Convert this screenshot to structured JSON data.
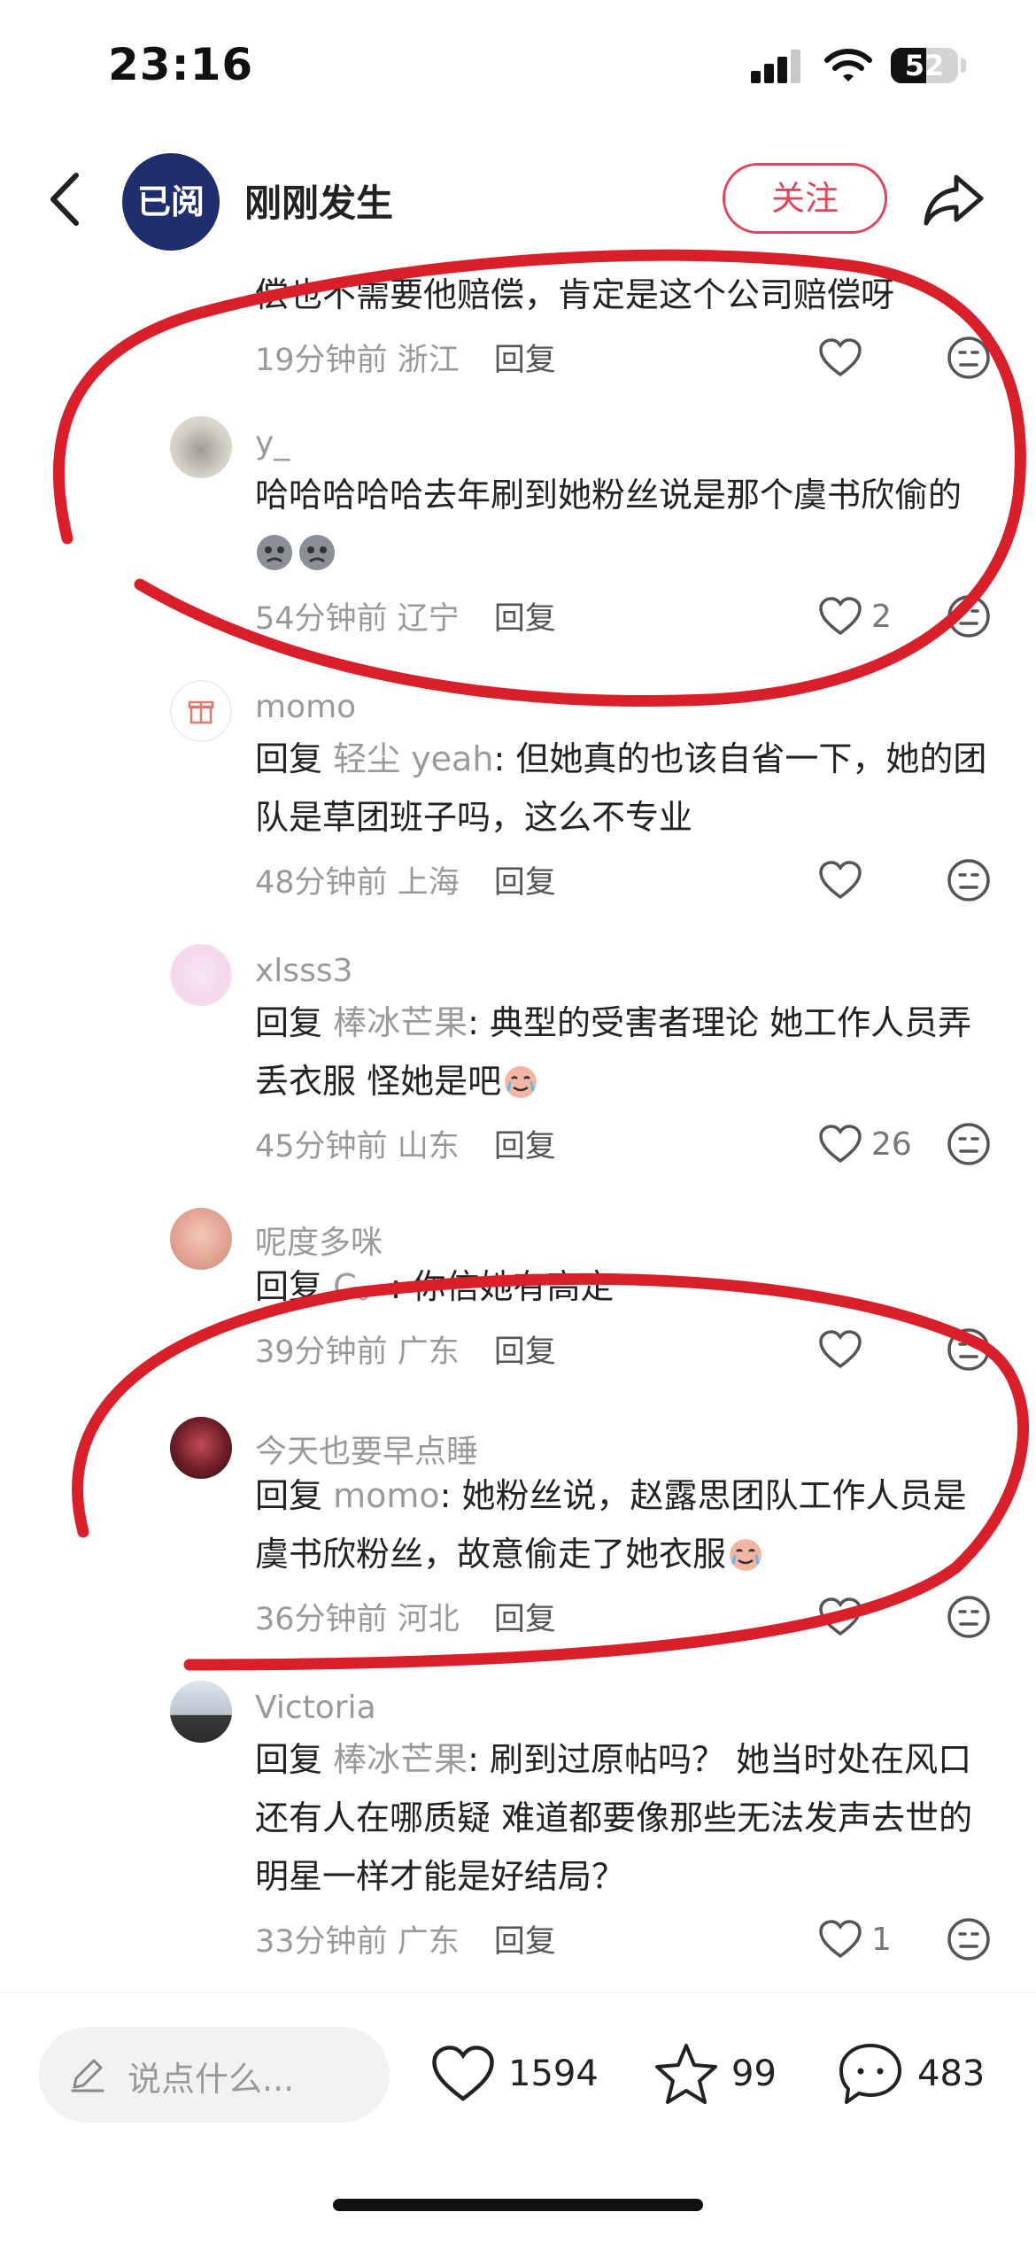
{
  "status_bar": {
    "time": "23:16",
    "battery": "52",
    "battery_level": 0.52
  },
  "header": {
    "channel_avatar_text": "已阅",
    "channel_name": "刚刚发生",
    "follow_label": "关注"
  },
  "comments": [
    {
      "text": "偿也不需要他赔偿，肯定是这个公司赔偿呀",
      "time": "19分钟前",
      "location": "浙江",
      "reply": "回复",
      "likes": ""
    },
    {
      "username": "y_",
      "text": "哈哈哈哈哈去年刷到她粉丝说是那个虞书欣偷的",
      "time": "54分钟前",
      "location": "辽宁",
      "reply": "回复",
      "likes": "2"
    },
    {
      "username": "momo",
      "reply_prefix": "回复",
      "reply_target": "轻尘 yeah",
      "text": ": 但她真的也该自省一下，她的团队是草团班子吗，这么不专业",
      "time": "48分钟前",
      "location": "上海",
      "reply": "回复",
      "likes": ""
    },
    {
      "username": "xlsss3",
      "reply_prefix": "回复",
      "reply_target": "棒冰芒果",
      "text": ": 典型的受害者理论 她工作人员弄丢衣服 怪她是吧",
      "time": "45分钟前",
      "location": "山东",
      "reply": "回复",
      "likes": "26"
    },
    {
      "username": "呢度多咪",
      "reply_prefix": "回复",
      "reply_target": "C。",
      "text": ": 你信她有高定",
      "time": "39分钟前",
      "location": "广东",
      "reply": "回复",
      "likes": ""
    },
    {
      "username": "今天也要早点睡",
      "reply_prefix": "回复",
      "reply_target": "momo",
      "text": ": 她粉丝说，赵露思团队工作人员是虞书欣粉丝，故意偷走了她衣服",
      "time": "36分钟前",
      "location": "河北",
      "reply": "回复",
      "likes": ""
    },
    {
      "username": "Victoria",
      "reply_prefix": "回复",
      "reply_target": "棒冰芒果",
      "text": ": 刷到过原帖吗？ 她当时处在风口还有人在哪质疑 难道都要像那些无法发声去世的明星一样才能是好结局？",
      "time": "33分钟前",
      "location": "广东",
      "reply": "回复",
      "likes": "1"
    }
  ],
  "bottom_bar": {
    "input_placeholder": "说点什么...",
    "likes": "1594",
    "favorites": "99",
    "comments": "483"
  },
  "colors": {
    "accent": "#e0485a",
    "annotation": "#d9202a",
    "channel": "#1f2f6e"
  }
}
